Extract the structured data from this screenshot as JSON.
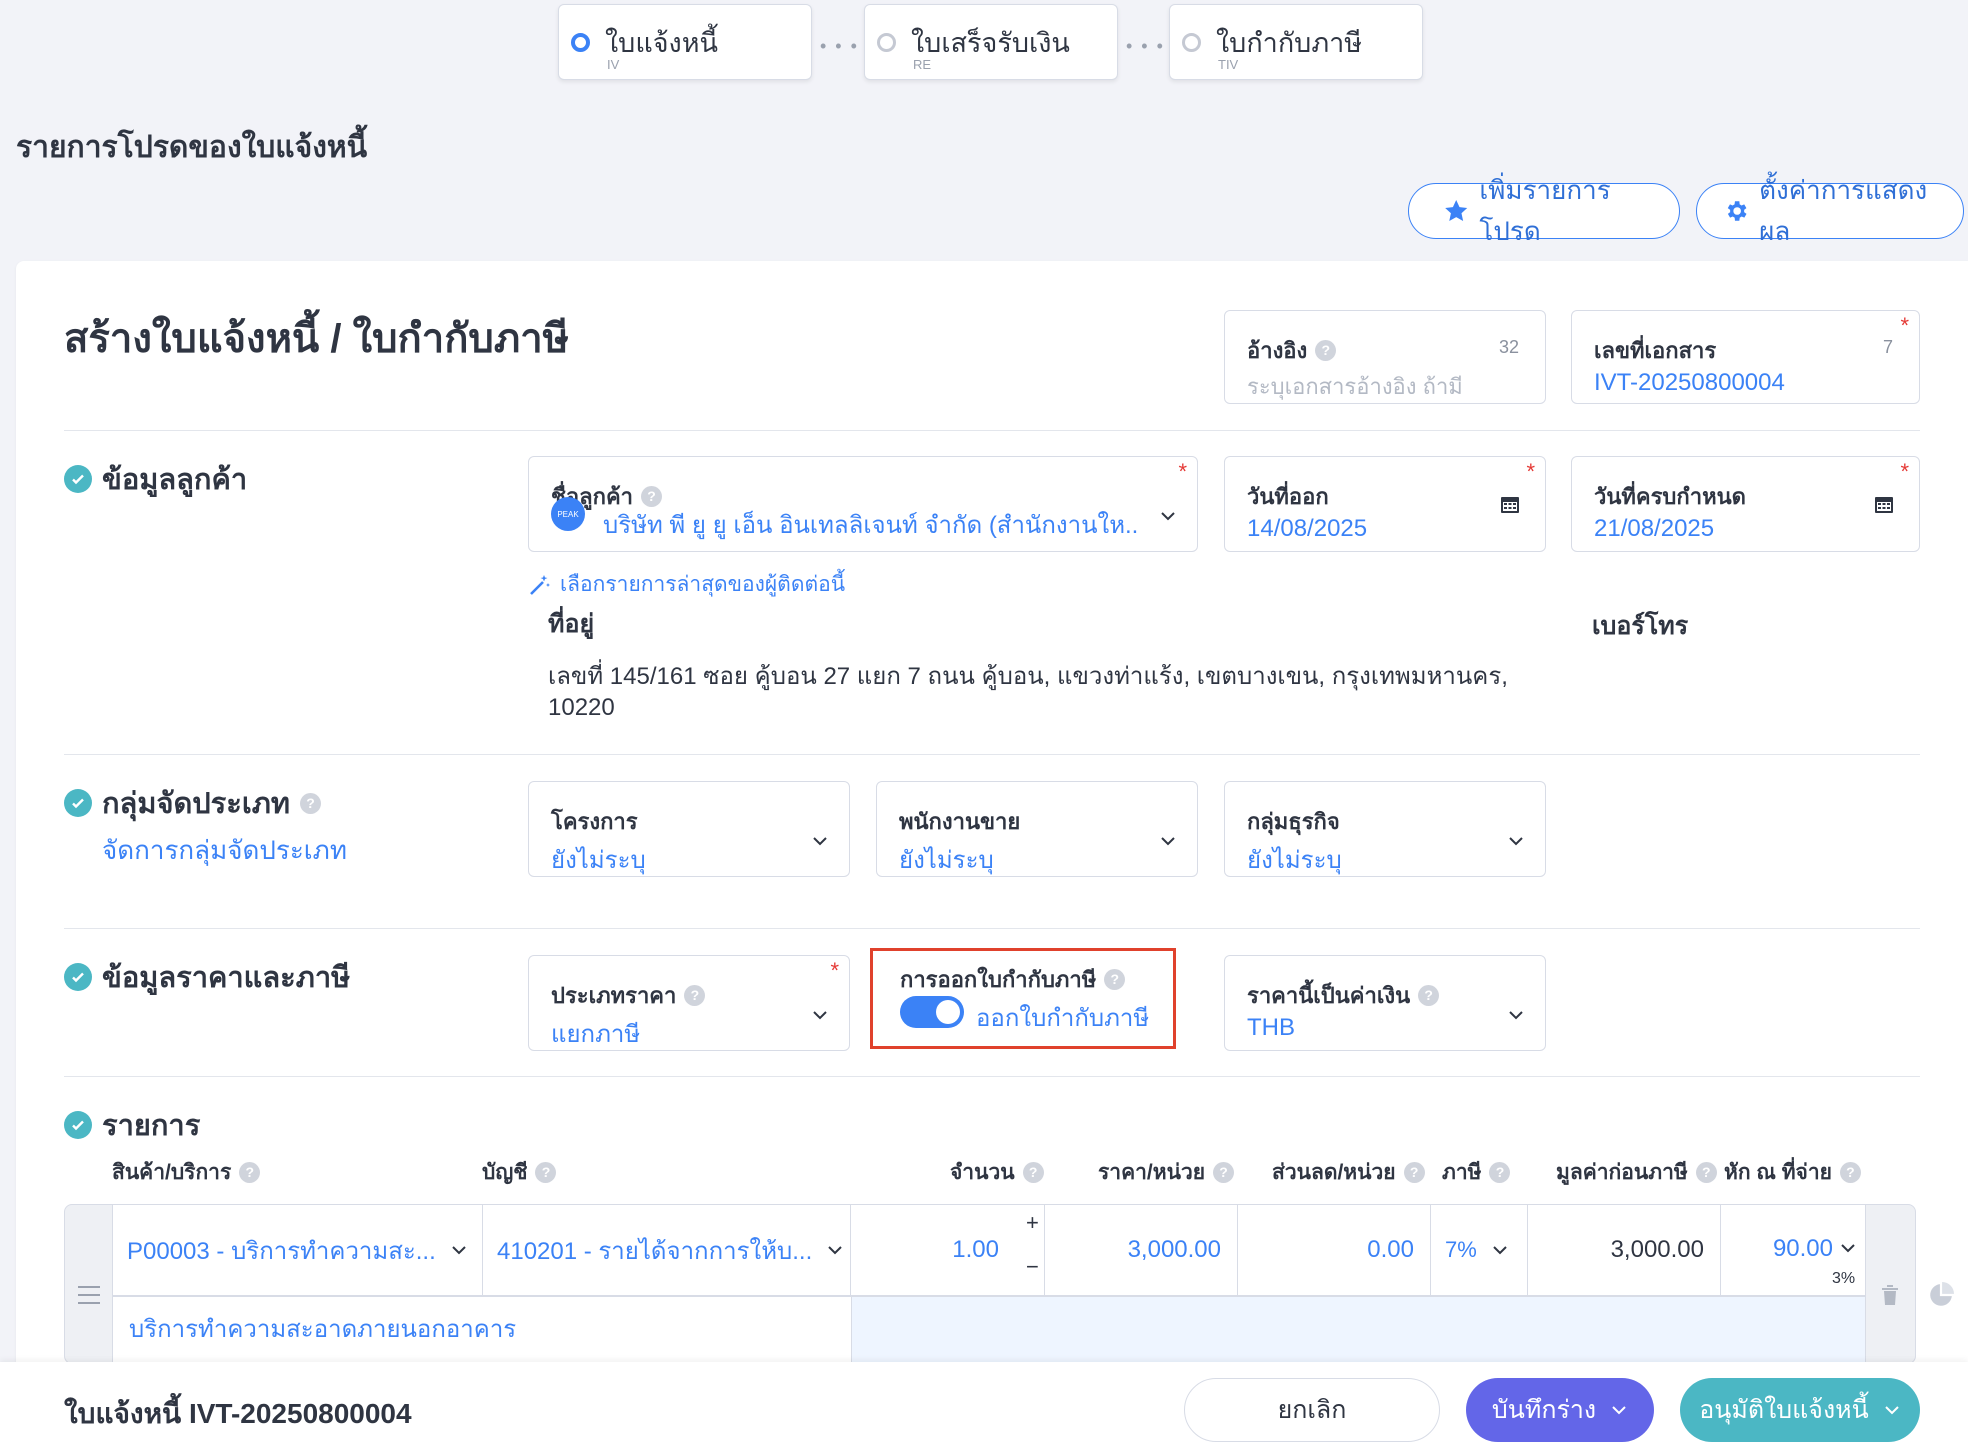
{
  "steps": [
    {
      "title": "ใบแจ้งหนี้",
      "code": "IV"
    },
    {
      "title": "ใบเสร็จรับเงิน",
      "code": "RE"
    },
    {
      "title": "ใบกำกับภาษี",
      "code": "TIV"
    }
  ],
  "page_heading": "รายการโปรดของใบแจ้งหนี้",
  "top_buttons": {
    "favorite": "เพิ่มรายการโปรด",
    "display_settings": "ตั้งค่าการแสดงผล"
  },
  "form_title": "สร้างใบแจ้งหนี้ / ใบกำกับภาษี",
  "reference": {
    "label": "อ้างอิง",
    "placeholder": "ระบุเอกสารอ้างอิง ถ้ามี",
    "counter": "32"
  },
  "doc_number": {
    "label": "เลขที่เอกสาร",
    "value": "IVT-20250800004",
    "counter": "7"
  },
  "customer_section": {
    "title": "ข้อมูลลูกค้า",
    "customer_label": "ชื่อลูกค้า",
    "customer_logo": "PEAK",
    "customer_value": "บริษัท พี ยู ยู เอ็น อินเทลลิเจนท์ จำกัด (สำนักงานให...",
    "issue_date_label": "วันที่ออก",
    "issue_date": "14/08/2025",
    "due_date_label": "วันที่ครบกำหนด",
    "due_date": "21/08/2025",
    "recent_link": "เลือกรายการล่าสุดของผู้ติดต่อนี้",
    "address_label": "ที่อยู่",
    "address_line1": "เลขที่ 145/161 ซอย คู้บอน 27 แยก 7 ถนน คู้บอน, แขวงท่าแร้ง, เขตบางเขน, กรุงเทพมหานคร,",
    "address_line2": "10220",
    "phone_label": "เบอร์โทร"
  },
  "category_section": {
    "title": "กลุ่มจัดประเภท",
    "manage_link": "จัดการกลุ่มจัดประเภท",
    "project_label": "โครงการ",
    "project_value": "ยังไม่ระบุ",
    "salesperson_label": "พนักงานขาย",
    "salesperson_value": "ยังไม่ระบุ",
    "business_group_label": "กลุ่มธุรกิจ",
    "business_group_value": "ยังไม่ระบุ"
  },
  "price_section": {
    "title": "ข้อมูลราคาและภาษี",
    "price_type_label": "ประเภทราคา",
    "price_type_value": "แยกภาษี",
    "tax_invoice_label": "การออกใบกำกับภาษี",
    "tax_invoice_toggle_label": "ออกใบกำกับภาษี",
    "tax_invoice_on": true,
    "currency_label": "ราคานี้เป็นค่าเงิน",
    "currency_value": "THB"
  },
  "items_section": {
    "title": "รายการ",
    "headers": {
      "product": "สินค้า/บริการ",
      "account": "บัญชี",
      "qty": "จำนวน",
      "unit_price": "ราคา/หน่วย",
      "discount": "ส่วนลด/หน่วย",
      "tax": "ภาษี",
      "pre_tax": "มูลค่าก่อนภาษี",
      "wht": "หัก ณ ที่จ่าย"
    },
    "row": {
      "product": "P00003 - บริการทำความสะ...",
      "account": "410201 - รายได้จากการให้บ...",
      "qty": "1.00",
      "unit_price": "3,000.00",
      "discount": "0.00",
      "tax": "7%",
      "pre_tax": "3,000.00",
      "wht": "90.00",
      "wht_rate": "3%",
      "description": "บริการทำความสะอาดภายนอกอาคาร"
    }
  },
  "footer": {
    "title": "ใบแจ้งหนี้ IVT-20250800004",
    "cancel": "ยกเลิก",
    "save_draft": "บันทึกร่าง",
    "approve": "อนุมัติใบแจ้งหนี้"
  },
  "colors": {
    "accent": "#3b82f6",
    "draft_button": "#6366e8",
    "approve_button": "#4bb7c4",
    "required": "#e53935",
    "highlight": "#e0412c"
  }
}
